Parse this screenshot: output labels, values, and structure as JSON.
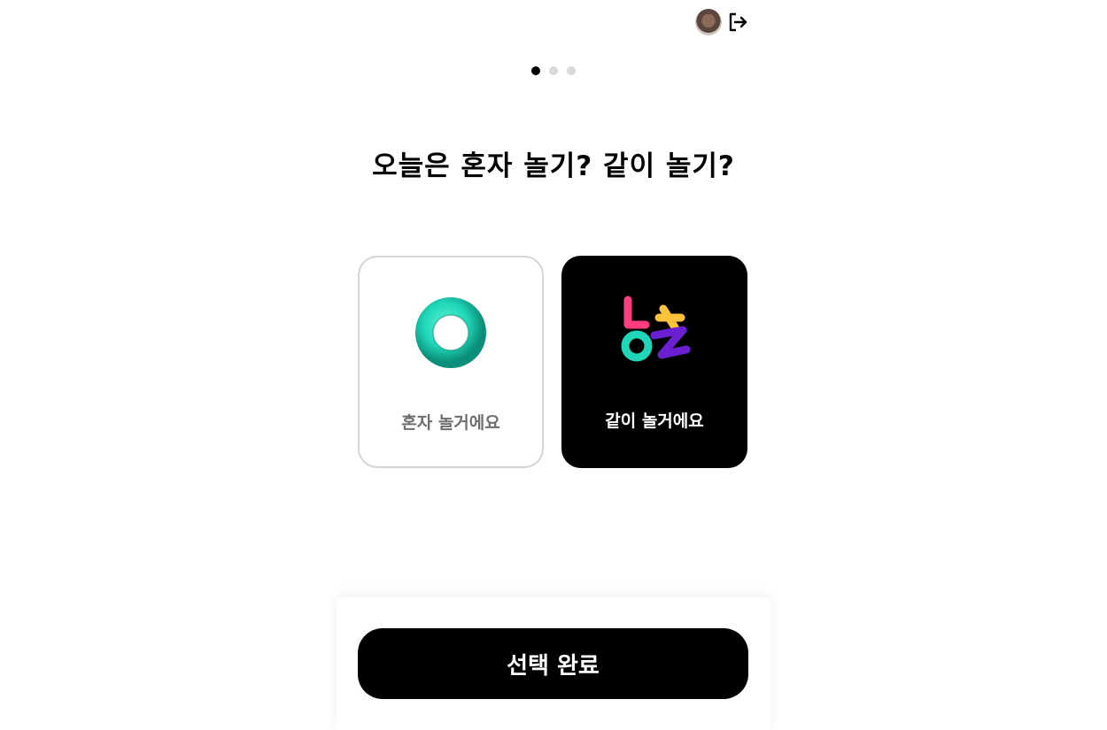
{
  "header": {
    "avatar_icon": "avatar",
    "logout_icon": "logout-icon"
  },
  "progress": {
    "total_steps": 3,
    "current_step": 1
  },
  "question": {
    "title": "오늘은 혼자 놀기? 같이 놀기?"
  },
  "options": [
    {
      "label": "혼자 놀거에요",
      "icon": "torus-icon",
      "selected": false
    },
    {
      "label": "같이 놀거에요",
      "icon": "together-letters-icon",
      "selected": true
    }
  ],
  "footer": {
    "submit_label": "선택 완료"
  },
  "colors": {
    "accent": "#000000",
    "torus": "#1fd6b8",
    "inactive_dot": "#d9d9d9",
    "card_border": "#d4d4d4"
  }
}
